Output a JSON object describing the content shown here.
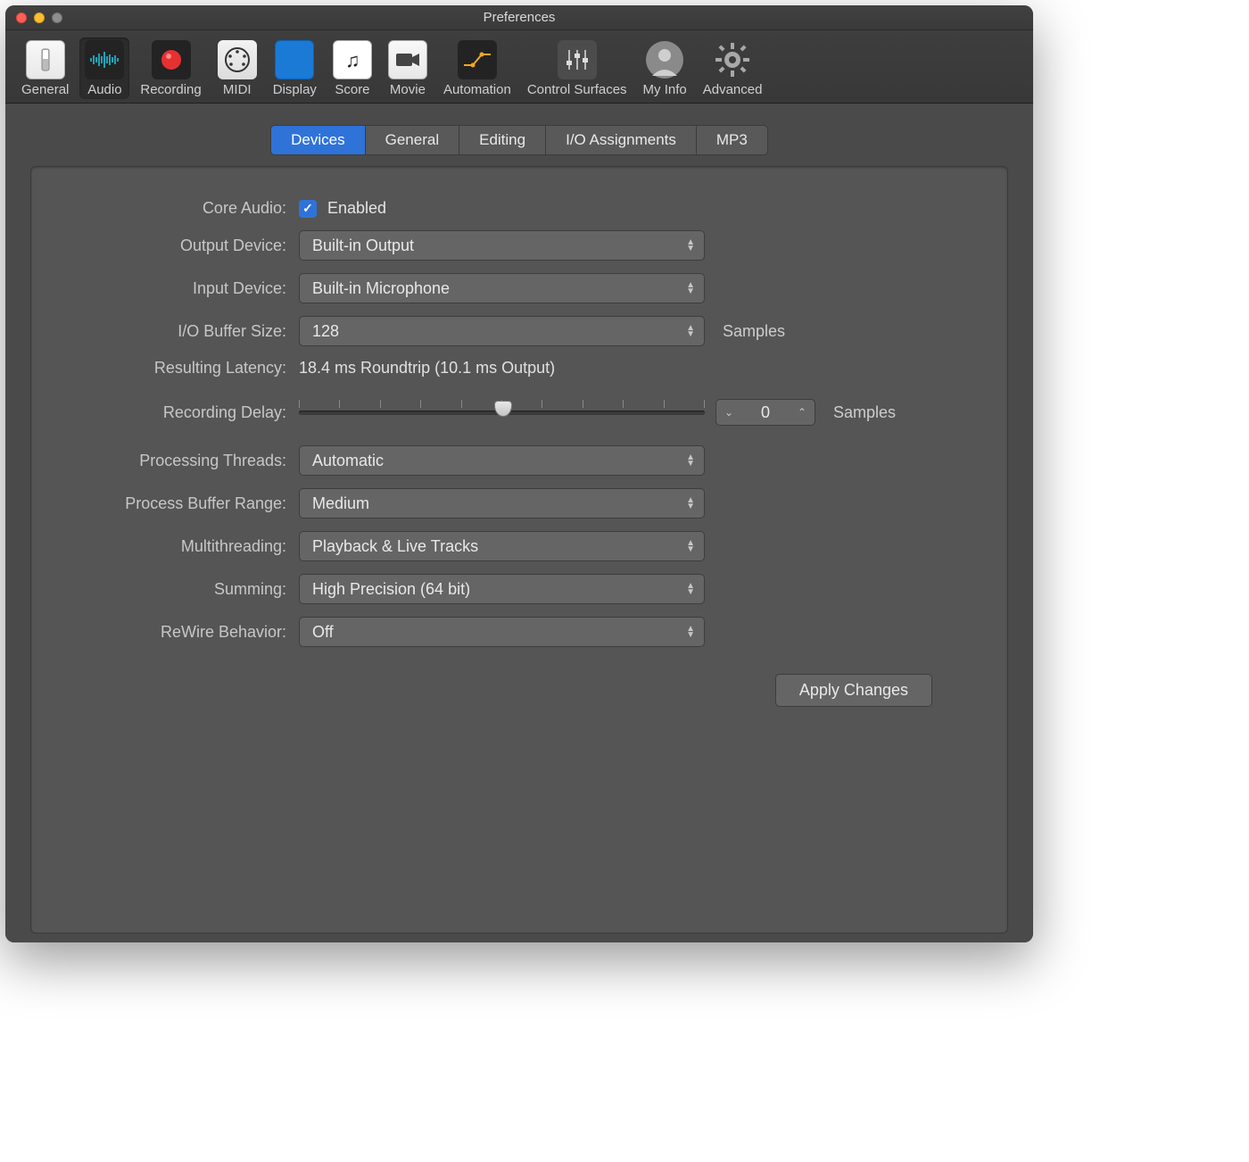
{
  "window": {
    "title": "Preferences"
  },
  "toolbar": {
    "items": [
      {
        "label": "General"
      },
      {
        "label": "Audio"
      },
      {
        "label": "Recording"
      },
      {
        "label": "MIDI"
      },
      {
        "label": "Display"
      },
      {
        "label": "Score"
      },
      {
        "label": "Movie"
      },
      {
        "label": "Automation"
      },
      {
        "label": "Control Surfaces"
      },
      {
        "label": "My Info"
      },
      {
        "label": "Advanced"
      }
    ],
    "selected": "Audio"
  },
  "subtabs": {
    "items": [
      "Devices",
      "General",
      "Editing",
      "I/O Assignments",
      "MP3"
    ],
    "selected": "Devices"
  },
  "form": {
    "core_audio": {
      "label": "Core Audio:",
      "checkbox_label": "Enabled",
      "checked": true
    },
    "output_device": {
      "label": "Output Device:",
      "value": "Built-in Output"
    },
    "input_device": {
      "label": "Input Device:",
      "value": "Built-in Microphone"
    },
    "io_buffer": {
      "label": "I/O Buffer Size:",
      "value": "128",
      "suffix": "Samples"
    },
    "latency": {
      "label": "Resulting Latency:",
      "value": "18.4 ms Roundtrip (10.1 ms Output)"
    },
    "recording_delay": {
      "label": "Recording Delay:",
      "value": "0",
      "suffix": "Samples"
    },
    "processing_threads": {
      "label": "Processing Threads:",
      "value": "Automatic"
    },
    "process_buffer_range": {
      "label": "Process Buffer Range:",
      "value": "Medium"
    },
    "multithreading": {
      "label": "Multithreading:",
      "value": "Playback & Live Tracks"
    },
    "summing": {
      "label": "Summing:",
      "value": "High Precision (64 bit)"
    },
    "rewire": {
      "label": "ReWire Behavior:",
      "value": "Off"
    },
    "apply": "Apply Changes"
  }
}
